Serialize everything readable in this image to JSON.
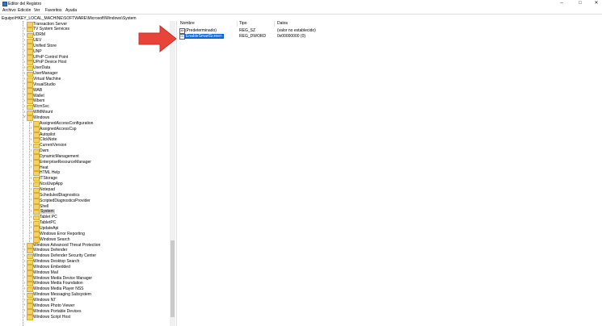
{
  "window": {
    "title": "Editor del Registro"
  },
  "menu": [
    "Archivo",
    "Edición",
    "Ver",
    "Favoritos",
    "Ayuda"
  ],
  "address": "Equipo\\HKEY_LOCAL_MACHINE\\SOFTWARE\\Microsoft\\Windows\\System",
  "columns": {
    "name": "Nombre",
    "type": "Tipo",
    "data": "Datos"
  },
  "values": [
    {
      "name": "(Predeterminado)",
      "type": "REG_SZ",
      "data": "(valor no establecido)",
      "icon": "string-value-icon",
      "selected": false
    },
    {
      "name": "EnableSmartScreen",
      "type": "REG_DWORD",
      "data": "0x00000000 (0)",
      "icon": "dword-value-icon",
      "selected": true
    }
  ],
  "tree": [
    {
      "label": "Transaction Server",
      "depth": 0,
      "exp": ""
    },
    {
      "label": "TV System Services",
      "depth": 0,
      "exp": ">"
    },
    {
      "label": "UDRM",
      "depth": 0,
      "exp": ">"
    },
    {
      "label": "UEV",
      "depth": 0,
      "exp": ">"
    },
    {
      "label": "Unified Store",
      "depth": 0,
      "exp": ">"
    },
    {
      "label": "UNP",
      "depth": 0,
      "exp": ">"
    },
    {
      "label": "UPnP Control Point",
      "depth": 0,
      "exp": ">"
    },
    {
      "label": "UPnP Device Host",
      "depth": 0,
      "exp": ">"
    },
    {
      "label": "UserData",
      "depth": 0,
      "exp": ">"
    },
    {
      "label": "UserManager",
      "depth": 0,
      "exp": ">"
    },
    {
      "label": "Virtual Machine",
      "depth": 0,
      "exp": ">"
    },
    {
      "label": "VisualStudio",
      "depth": 0,
      "exp": ">"
    },
    {
      "label": "WAB",
      "depth": 0,
      "exp": ">"
    },
    {
      "label": "Wallet",
      "depth": 0,
      "exp": ">"
    },
    {
      "label": "Wbem",
      "depth": 0,
      "exp": ">"
    },
    {
      "label": "WcmSvc",
      "depth": 0,
      "exp": ">"
    },
    {
      "label": "WIMMount",
      "depth": 0,
      "exp": ">"
    },
    {
      "label": "Windows",
      "depth": 0,
      "exp": "v"
    },
    {
      "label": "AssignedAccessConfiguration",
      "depth": 1,
      "exp": ">"
    },
    {
      "label": "AssignedAccessCsp",
      "depth": 1,
      "exp": ">"
    },
    {
      "label": "Autopilot",
      "depth": 1,
      "exp": ">"
    },
    {
      "label": "ClickNote",
      "depth": 1,
      "exp": ">"
    },
    {
      "label": "CurrentVersion",
      "depth": 1,
      "exp": ">"
    },
    {
      "label": "Dwm",
      "depth": 1,
      "exp": ">"
    },
    {
      "label": "DynamicManagement",
      "depth": 1,
      "exp": ">"
    },
    {
      "label": "EnterpriseResourceManager",
      "depth": 1,
      "exp": ">"
    },
    {
      "label": "Heat",
      "depth": 1,
      "exp": ">"
    },
    {
      "label": "HTML Help",
      "depth": 1,
      "exp": ""
    },
    {
      "label": "ITStorage",
      "depth": 1,
      "exp": ">"
    },
    {
      "label": "NcsiUwpApp",
      "depth": 1,
      "exp": ">"
    },
    {
      "label": "Notepad",
      "depth": 1,
      "exp": ">"
    },
    {
      "label": "ScheduledDiagnostics",
      "depth": 1,
      "exp": ">"
    },
    {
      "label": "ScriptedDiagnosticsProvider",
      "depth": 1,
      "exp": ">"
    },
    {
      "label": "Shell",
      "depth": 1,
      "exp": ">"
    },
    {
      "label": "System",
      "depth": 1,
      "exp": ">",
      "selected": true
    },
    {
      "label": "Tablet PC",
      "depth": 1,
      "exp": ">"
    },
    {
      "label": "TabletPC",
      "depth": 1,
      "exp": ">"
    },
    {
      "label": "UpdateApi",
      "depth": 1,
      "exp": ">"
    },
    {
      "label": "Windows Error Reporting",
      "depth": 1,
      "exp": ">"
    },
    {
      "label": "Windows Search",
      "depth": 1,
      "exp": ">"
    },
    {
      "label": "Windows Advanced Threat Protection",
      "depth": 0,
      "exp": ">"
    },
    {
      "label": "Windows Defender",
      "depth": 0,
      "exp": ">"
    },
    {
      "label": "Windows Defender Security Center",
      "depth": 0,
      "exp": ">"
    },
    {
      "label": "Windows Desktop Search",
      "depth": 0,
      "exp": ">"
    },
    {
      "label": "Windows Embedded",
      "depth": 0,
      "exp": ">"
    },
    {
      "label": "Windows Mail",
      "depth": 0,
      "exp": ">"
    },
    {
      "label": "Windows Media Device Manager",
      "depth": 0,
      "exp": ">"
    },
    {
      "label": "Windows Media Foundation",
      "depth": 0,
      "exp": ">"
    },
    {
      "label": "Windows Media Player NSS",
      "depth": 0,
      "exp": ">"
    },
    {
      "label": "Windows Messaging Subsystem",
      "depth": 0,
      "exp": ">"
    },
    {
      "label": "Windows NT",
      "depth": 0,
      "exp": ">"
    },
    {
      "label": "Windows Photo Viewer",
      "depth": 0,
      "exp": ">"
    },
    {
      "label": "Windows Portable Devices",
      "depth": 0,
      "exp": ">"
    },
    {
      "label": "Windows Script Host",
      "depth": 0,
      "exp": ">"
    }
  ],
  "colors": {
    "arrow": "#e8443a",
    "selection": "#0a64d6",
    "folder": "#f4d06a"
  }
}
